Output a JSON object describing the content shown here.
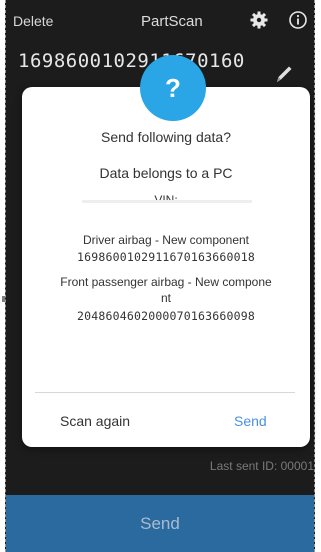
{
  "topbar": {
    "delete_label": "Delete",
    "title": "PartScan",
    "settings_icon": "gear-icon",
    "info_icon": "info-icon"
  },
  "scan": {
    "value_visible": "1698600102911670160",
    "edit_icon": "pencil-icon"
  },
  "dialog": {
    "badge_icon": "question-icon",
    "badge_text": "?",
    "question": "Send following data?",
    "belongs_to": "Data belongs to a PC",
    "vin_label": "VIN:",
    "components": [
      {
        "label": "Driver airbag - New component",
        "code": "1698600102911670163660018"
      },
      {
        "label_line1": "Front passenger airbag - New compone",
        "label_line2": "nt",
        "code": "2048604602000070163660098"
      }
    ],
    "scan_again_label": "Scan again",
    "send_label": "Send"
  },
  "footer": {
    "last_sent": "Last sent ID: 00001",
    "send_label": "Send"
  },
  "colors": {
    "app_background": "#1c1c1c",
    "send_bar": "#2b6a9f",
    "badge": "#2aa5e6",
    "dialog_action": "#4a90e2"
  }
}
